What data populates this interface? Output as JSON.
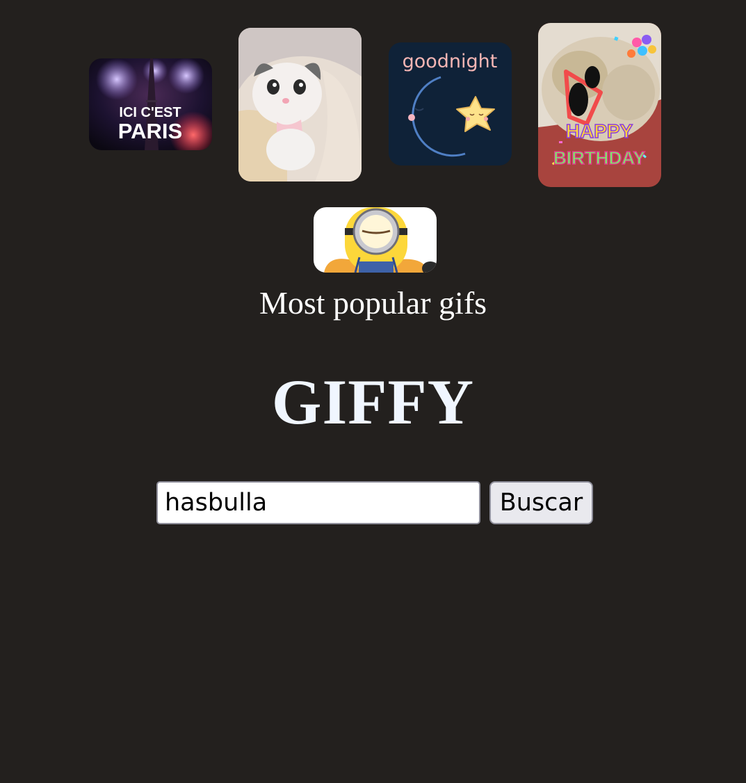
{
  "popular_gifs": [
    {
      "name": "paris-fireworks-gif",
      "caption_line1": "ICI C'EST",
      "caption_line2": "PARIS"
    },
    {
      "name": "cat-in-blanket-gif"
    },
    {
      "name": "goodnight-moon-star-gif",
      "caption": "goodnight"
    },
    {
      "name": "happy-birthday-dog-gif",
      "caption_line1": "HAPPY",
      "caption_line2": "BIRTHDAY"
    },
    {
      "name": "minion-gif"
    }
  ],
  "section_title": "Most popular gifs",
  "app_title": "GIFFY",
  "search": {
    "value": "hasbulla",
    "button_label": "Buscar"
  },
  "colors": {
    "background": "#23201e",
    "title_text": "#f0f6ff"
  }
}
